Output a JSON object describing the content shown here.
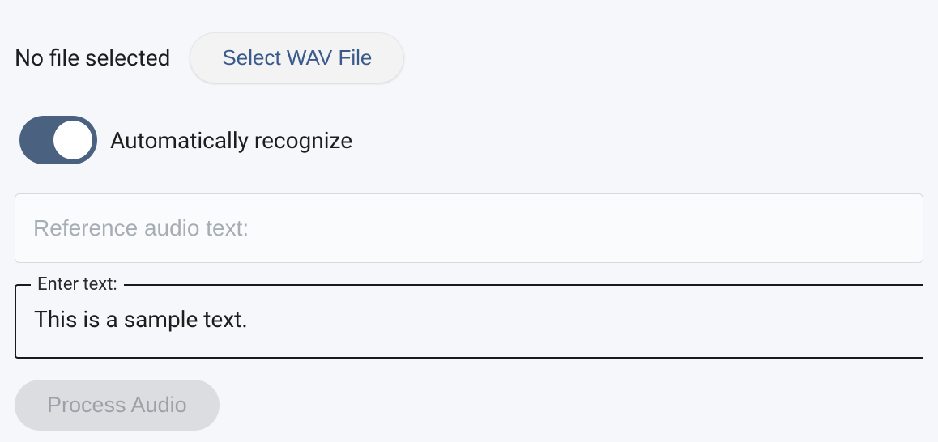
{
  "file": {
    "status": "No file selected",
    "select_button_label": "Select WAV File"
  },
  "auto_recognize": {
    "label": "Automatically recognize",
    "enabled": true
  },
  "reference_input": {
    "placeholder": "Reference audio text:",
    "value": ""
  },
  "enter_text": {
    "legend": "Enter text:",
    "value": "This is a sample text."
  },
  "process_button": {
    "label": "Process Audio",
    "disabled": true
  }
}
